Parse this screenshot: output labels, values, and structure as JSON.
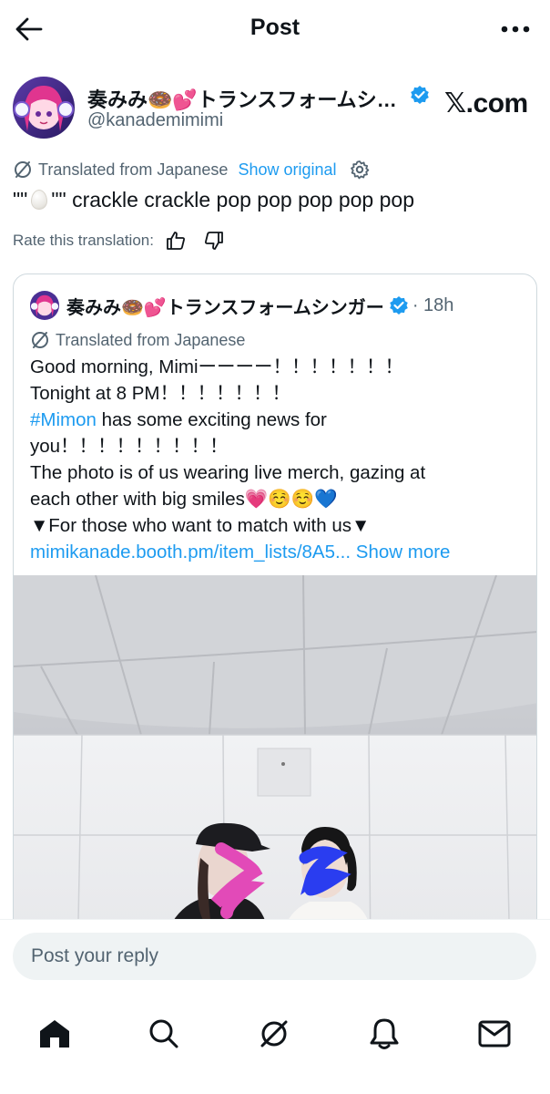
{
  "header": {
    "title": "Post"
  },
  "post": {
    "author_name": "奏みみ🍩💕トランスフォームシンガー",
    "handle": "@kanademimimi",
    "watermark": "𝕏.com",
    "translated_label": "Translated from Japanese",
    "show_original": "Show original",
    "text_start": "\"\"",
    "text_end": "\"\" crackle crackle pop pop pop pop pop",
    "rate_label": "Rate this translation:"
  },
  "quote": {
    "author_name": "奏みみ🍩💕トランスフォームシンガー",
    "time": "· 18h",
    "translated_label": "Translated from Japanese",
    "line1": "Good morning, Mimiーーーー！！！！！！！",
    "line2": "Tonight at 8 PM！！！！！！！",
    "hashtag": "#Mimon",
    "line3_rest": " has some exciting news for",
    "line4": "you！！！！！！！！！",
    "line5": "The photo is of us wearing live merch, gazing at",
    "line6": "each other with big smiles💗☺️☺️💙",
    "line7": "▼For those who want to match with us▼",
    "link": "mimikanade.booth.pm/item_lists/8A5...",
    "show_more": "Show more"
  },
  "reply": {
    "placeholder": "Post your reply"
  },
  "nav": {
    "items": [
      "home",
      "search",
      "grok",
      "notifications",
      "messages"
    ]
  },
  "colors": {
    "accent": "#1d9bf0",
    "muted": "#536471",
    "text": "#0f1419",
    "border": "#cfd9de"
  }
}
